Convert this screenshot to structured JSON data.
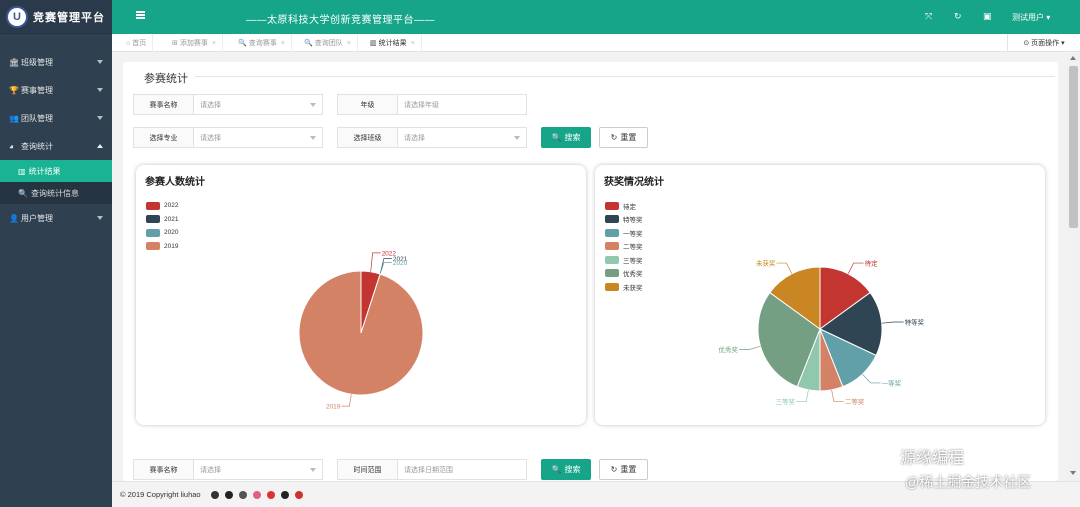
{
  "app": {
    "logo_badge": "U",
    "logo_text": "竞赛管理平台",
    "header_title": "——太原科技大学创新竞赛管理平台——",
    "user_label": "测试用户 ▾"
  },
  "sidebar": {
    "items": [
      {
        "label": "班级管理",
        "icon": "🏛"
      },
      {
        "label": "赛事管理",
        "icon": "🏆"
      },
      {
        "label": "团队管理",
        "icon": "👥"
      },
      {
        "label": "查询统计",
        "icon": "◕"
      }
    ],
    "sub_items": [
      {
        "label": "统计结果",
        "icon": "▥"
      },
      {
        "label": "查询统计信息",
        "icon": "🔍"
      }
    ],
    "last_item": {
      "label": "用户管理",
      "icon": "👤"
    }
  },
  "tabs": [
    {
      "label": "首页",
      "icon": "⌂"
    },
    {
      "label": "添加赛事",
      "icon": "⊞"
    },
    {
      "label": "查询赛事",
      "icon": "🔍"
    },
    {
      "label": "查询团队",
      "icon": "🔍"
    },
    {
      "label": "统计结果",
      "icon": "▥"
    }
  ],
  "page_op": "⊙ 页面操作 ▾",
  "section": {
    "title": "参赛统计"
  },
  "filters": {
    "competition": {
      "label": "赛事名称",
      "placeholder": "请选择"
    },
    "grade": {
      "label": "年级",
      "placeholder": "请选择年级"
    },
    "major": {
      "label": "选择专业",
      "placeholder": "请选择"
    },
    "class": {
      "label": "选择班级",
      "placeholder": "请选择"
    },
    "search_btn": "搜索",
    "reset_btn": "重置"
  },
  "filters2": {
    "competition": {
      "label": "赛事名称",
      "placeholder": "请选择"
    },
    "time": {
      "label": "时间范围",
      "placeholder": "请选择日期范围"
    },
    "search_btn": "搜索",
    "reset_btn": "重置"
  },
  "chart_data": [
    {
      "type": "pie",
      "title": "参赛人数统计",
      "categories": [
        "2022",
        "2021",
        "2020",
        "2019"
      ],
      "values": [
        1,
        0,
        0,
        19
      ],
      "colors": [
        "#c23531",
        "#2f4554",
        "#61a0a8",
        "#d48265"
      ]
    },
    {
      "type": "pie",
      "title": "获奖情况统计",
      "categories": [
        "待定",
        "特等奖",
        "一等奖",
        "二等奖",
        "三等奖",
        "优秀奖",
        "未获奖"
      ],
      "values": [
        15,
        17,
        12,
        6,
        6,
        29,
        15
      ],
      "colors": [
        "#c23531",
        "#2f4554",
        "#61a0a8",
        "#d48265",
        "#91c7ae",
        "#749f83",
        "#ca8622"
      ]
    }
  ],
  "footer": {
    "copyright": "© 2019 Copyright liuhao"
  },
  "watermark": {
    "line1": "源缘编程",
    "line2": "@稀土掘金技术社区"
  }
}
